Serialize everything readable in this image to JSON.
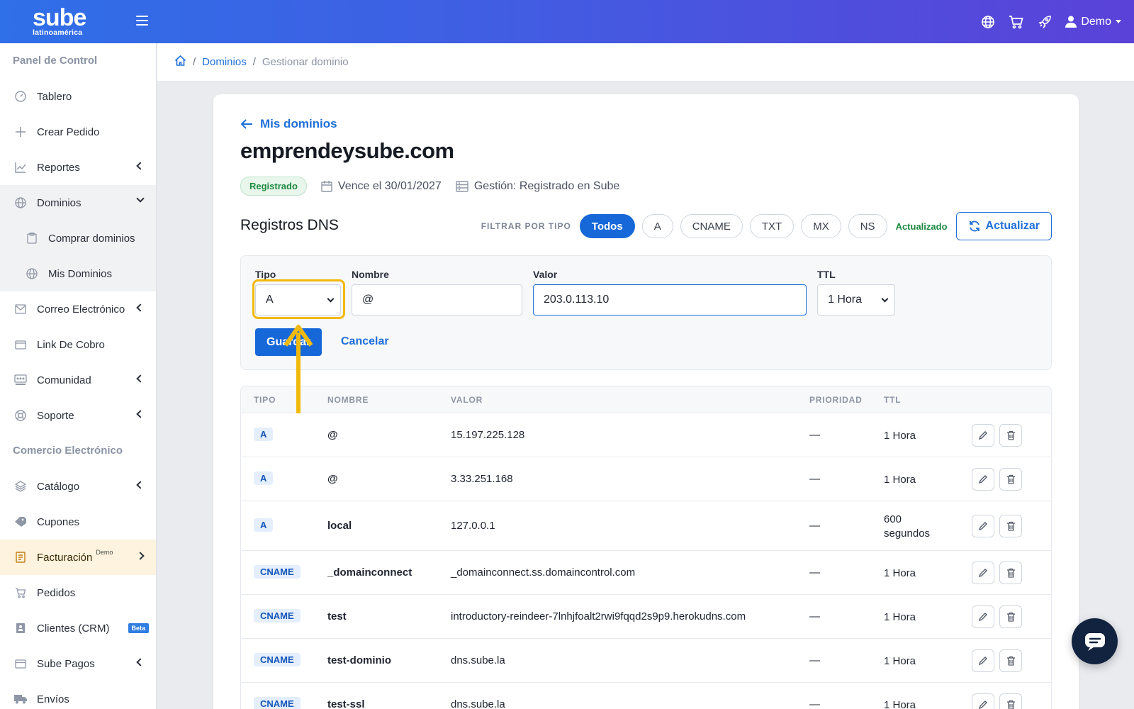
{
  "topbar": {
    "brand": "sube",
    "brand_sub": "latinoamérica",
    "user_label": "Demo",
    "icons": [
      "globe-icon",
      "cart-icon",
      "rocket-icon",
      "user-icon"
    ]
  },
  "sidebar": {
    "section1": "Panel de Control",
    "items1": [
      {
        "label": "Tablero",
        "icon": "gauge-icon"
      },
      {
        "label": "Crear Pedido",
        "icon": "plus-icon"
      },
      {
        "label": "Reportes",
        "icon": "chart-icon"
      },
      {
        "label": "Dominios",
        "icon": "globe-icon"
      },
      {
        "label": "Comprar dominios",
        "icon": "clipboard-icon"
      },
      {
        "label": "Mis Dominios",
        "icon": "globe-icon"
      },
      {
        "label": "Correo Electrónico",
        "icon": "mail-icon"
      },
      {
        "label": "Link De Cobro",
        "icon": "wallet-icon"
      },
      {
        "label": "Comunidad",
        "icon": "community-icon"
      },
      {
        "label": "Soporte",
        "icon": "lifebuoy-icon"
      }
    ],
    "section2": "Comercio Electrónico",
    "items2": [
      {
        "label": "Catálogo",
        "icon": "layers-icon"
      },
      {
        "label": "Cupones",
        "icon": "tag-icon"
      },
      {
        "label": "Facturación",
        "icon": "invoice-icon",
        "sup": "Demo"
      },
      {
        "label": "Pedidos",
        "icon": "cart-icon"
      },
      {
        "label": "Clientes (CRM)",
        "icon": "contacts-icon",
        "badge": "Beta"
      },
      {
        "label": "Sube Pagos",
        "icon": "card-icon"
      },
      {
        "label": "Envíos",
        "icon": "truck-icon"
      }
    ]
  },
  "breadcrumb": {
    "link": "Dominios",
    "current": "Gestionar dominio"
  },
  "domain": {
    "back_label": "Mis dominios",
    "name": "emprendeysube.com",
    "status": "Registrado",
    "expires": "Vence el 30/01/2027",
    "management": "Gestión: Registrado en Sube"
  },
  "dns": {
    "title": "Registros DNS",
    "filter_label": "FILTRAR POR TIPO",
    "filters": [
      "Todos",
      "A",
      "CNAME",
      "TXT",
      "MX",
      "NS"
    ],
    "active_filter": "Todos",
    "updated_label": "Actualizado",
    "refresh_label": "Actualizar"
  },
  "form": {
    "type_label": "Tipo",
    "type_value": "A",
    "name_label": "Nombre",
    "name_value": "@",
    "value_label": "Valor",
    "value_value": "203.0.113.10",
    "ttl_label": "TTL",
    "ttl_value": "1 Hora",
    "save_label": "Guardar",
    "cancel_label": "Cancelar"
  },
  "table": {
    "headers": {
      "type": "TIPO",
      "name": "NOMBRE",
      "value": "VALOR",
      "priority": "PRIORIDAD",
      "ttl": "TTL"
    },
    "rows": [
      {
        "type": "A",
        "name": "@",
        "value": "15.197.225.128",
        "priority": "—",
        "ttl": "1 Hora"
      },
      {
        "type": "A",
        "name": "@",
        "value": "3.33.251.168",
        "priority": "—",
        "ttl": "1 Hora"
      },
      {
        "type": "A",
        "name": "local",
        "value": "127.0.0.1",
        "priority": "—",
        "ttl": "600 segundos"
      },
      {
        "type": "CNAME",
        "name": "_domainconnect",
        "value": "_domainconnect.ss.domaincontrol.com",
        "priority": "—",
        "ttl": "1 Hora"
      },
      {
        "type": "CNAME",
        "name": "test",
        "value": "introductory-reindeer-7lnhjfoalt2rwi9fqqd2s9p9.herokudns.com",
        "priority": "—",
        "ttl": "1 Hora"
      },
      {
        "type": "CNAME",
        "name": "test-dominio",
        "value": "dns.sube.la",
        "priority": "—",
        "ttl": "1 Hora"
      },
      {
        "type": "CNAME",
        "name": "test-ssl",
        "value": "dns.sube.la",
        "priority": "—",
        "ttl": "1 Hora"
      }
    ]
  },
  "colors": {
    "primary": "#1668d9",
    "highlight": "#f2b90d",
    "success": "#1f8a41",
    "topbar_start": "#2f6fe8",
    "topbar_end": "#5a42d8"
  }
}
